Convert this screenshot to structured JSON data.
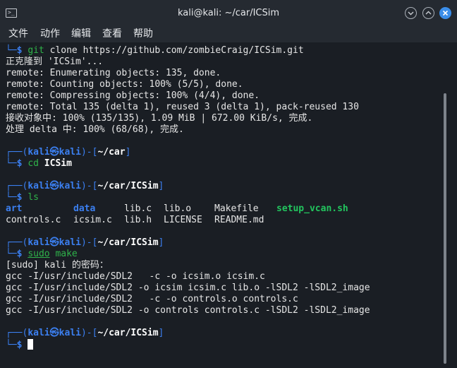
{
  "window": {
    "title": "kali@kali: ~/car/ICSim"
  },
  "menu": [
    "文件",
    "动作",
    "编辑",
    "查看",
    "帮助"
  ],
  "prompt": {
    "user": "kali",
    "at": "㉿",
    "host": "kali",
    "symbol": "$"
  },
  "blocks": [
    {
      "cmd": "git",
      "args": " clone https://github.com/zombieCraig/ICSim.git"
    },
    {
      "output": [
        "正克隆到 'ICSim'...",
        "remote: Enumerating objects: 135, done.",
        "remote: Counting objects: 100% (5/5), done.",
        "remote: Compressing objects: 100% (4/4), done.",
        "remote: Total 135 (delta 1), reused 3 (delta 1), pack-reused 130",
        "接收对象中: 100% (135/135), 1.09 MiB | 672.00 KiB/s, 完成.",
        "处理 delta 中: 100% (68/68), 完成."
      ]
    },
    {
      "path": "~/car",
      "cmd": "cd",
      "args": " ",
      "arg_bold": "ICSim"
    },
    {
      "path": "~/car/ICSim",
      "cmd": "ls",
      "args": ""
    },
    {
      "ls_rows": [
        [
          "art",
          "data",
          "lib.c",
          "lib.o",
          "Makefile",
          "setup_vcan.sh"
        ],
        [
          "controls.c",
          "icsim.c",
          "lib.h",
          "LICENSE",
          "README.md",
          ""
        ]
      ]
    },
    {
      "path": "~/car/ICSim",
      "cmd": "sudo",
      "args": " make"
    },
    {
      "output": [
        "[sudo] kali 的密码：",
        "gcc -I/usr/include/SDL2   -c -o icsim.o icsim.c",
        "gcc -I/usr/include/SDL2 -o icsim icsim.c lib.o -lSDL2 -lSDL2_image",
        "gcc -I/usr/include/SDL2   -c -o controls.o controls.c",
        "gcc -I/usr/include/SDL2 -o controls controls.c -lSDL2 -lSDL2_image"
      ]
    },
    {
      "path": "~/car/ICSim"
    }
  ]
}
